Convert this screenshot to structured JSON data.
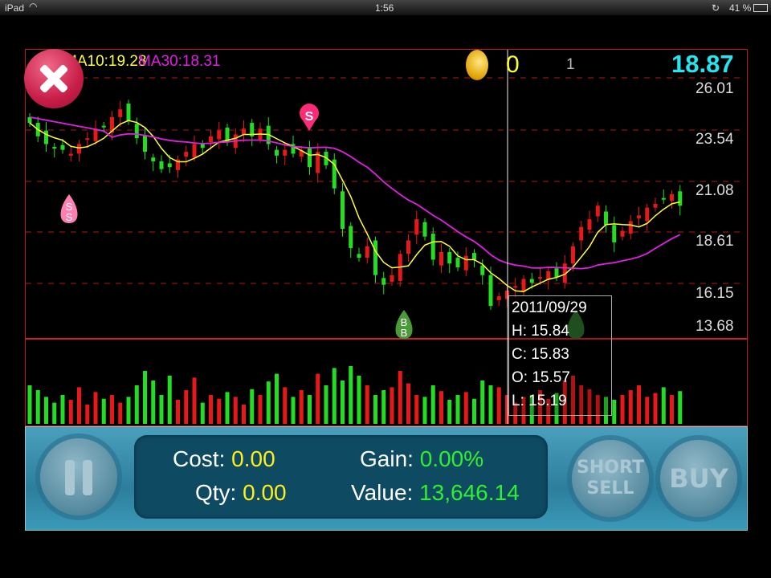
{
  "status_bar": {
    "device": "iPad",
    "time": "1:56",
    "battery": "41 %"
  },
  "chart_header": {
    "ma_short_label": "MA10:19.28",
    "ma30_label": "MA30:18.31",
    "coins": "0",
    "level": "1",
    "current_price": "18.87"
  },
  "colors": {
    "ma_short": "#ffff33",
    "ma30": "#e020e0",
    "up": "#e81818",
    "down": "#22dd22",
    "price": "#22e6f0",
    "grid": "#b01818"
  },
  "markers": {
    "sell": "S",
    "short_sell": "S",
    "buy": "B"
  },
  "tooltip": {
    "date": "2011/09/29",
    "high": "H: 15.84",
    "close": "C: 15.83",
    "open": "O: 15.57",
    "low": "L: 15.19"
  },
  "chart_data": {
    "type": "candlestick",
    "y_ticks": [
      "26.01",
      "23.54",
      "21.08",
      "18.61",
      "16.15",
      "13.68"
    ],
    "ylim": [
      13.68,
      27.2
    ],
    "closes": [
      24.3,
      23.6,
      23.2,
      23.0,
      22.9,
      22.7,
      23.2,
      23.5,
      24.0,
      24.1,
      24.6,
      25.0,
      24.4,
      23.5,
      22.8,
      22.3,
      21.9,
      22.0,
      22.4,
      22.8,
      23.2,
      23.0,
      23.6,
      23.9,
      23.3,
      23.7,
      24.0,
      23.6,
      24.0,
      23.2,
      22.6,
      22.9,
      22.7,
      22.9,
      22.0,
      22.8,
      22.1,
      20.9,
      18.8,
      17.8,
      17.3,
      17.9,
      16.4,
      15.9,
      16.4,
      17.5,
      18.2,
      19.3,
      18.4,
      17.2,
      17.6,
      17.0,
      16.8,
      17.4,
      17.2,
      16.4,
      14.8,
      15.3,
      15.6,
      15.83,
      16.2,
      16.0,
      16.3,
      16.6,
      16.3,
      17.0,
      17.9,
      18.9,
      19.3,
      20.0,
      19.0,
      18.1,
      18.7,
      19.2,
      19.5,
      19.9,
      20.1,
      20.4,
      20.6,
      20.0
    ],
    "volumes": [
      40,
      35,
      28,
      22,
      30,
      25,
      38,
      20,
      33,
      26,
      30,
      22,
      28,
      40,
      55,
      45,
      30,
      50,
      25,
      35,
      48,
      22,
      30,
      26,
      33,
      28,
      20,
      36,
      30,
      44,
      52,
      38,
      28,
      35,
      30,
      52,
      40,
      58,
      45,
      60,
      50,
      40,
      30,
      35,
      38,
      55,
      42,
      30,
      28,
      40,
      34,
      25,
      30,
      33,
      26,
      45,
      40,
      38,
      30,
      22,
      28,
      30,
      35,
      26,
      32,
      45,
      50,
      40,
      36,
      30,
      28,
      25,
      30,
      35,
      40,
      28,
      32,
      38,
      30,
      34
    ],
    "selected_index": 59
  },
  "panel": {
    "cost_label": "Cost:",
    "cost": "0.00",
    "qty_label": "Qty:",
    "qty": "0.00",
    "gain_label": "Gain:",
    "gain": "0.00%",
    "value_label": "Value:",
    "value": "13,646.14",
    "short_sell_line1": "SHORT",
    "short_sell_line2": "SELL",
    "buy": "BUY"
  }
}
